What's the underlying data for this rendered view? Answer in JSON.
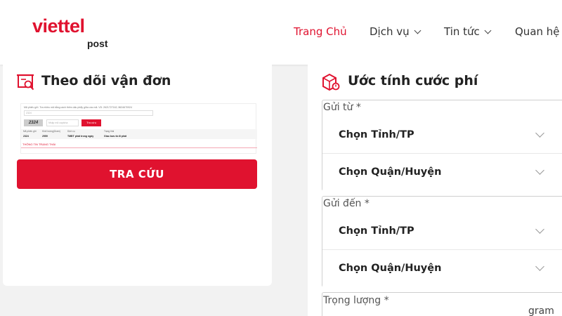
{
  "brand": {
    "name": "viettel",
    "sub": "post"
  },
  "nav": {
    "items": [
      {
        "label": "Trang Chủ",
        "active": true
      },
      {
        "label": "Dịch vụ",
        "dropdown": true
      },
      {
        "label": "Tin tức",
        "dropdown": true
      },
      {
        "label": "Quan hệ c",
        "dropdown": false
      }
    ]
  },
  "tracking": {
    "title": "Theo dõi vận đơn",
    "icon": "tracking-search-icon",
    "preview": {
      "hint": "Mã phiếu gửi. Tra nhiều mã bằng cách thêm dấu phẩy giữa các mã. VD: 2621727162, 8624670924",
      "input_placeholder": "2324",
      "captcha_text": "2324",
      "captcha_placeholder": "Nhập mã captcha",
      "button": "Tra cứu",
      "columns": [
        "Mã phiếu gửi",
        "Khối lượng(Gram)",
        "Dịch vụ",
        "Trạng thái"
      ],
      "values": [
        "2324",
        "2959",
        "TMĐT phát trong ngày",
        "Giao bưu tá đi phát"
      ],
      "status_heading": "THÔNG TIN TRẠNG THÁI"
    },
    "button_label": "TRA CỨU"
  },
  "estimate": {
    "title": "Ước tính cước phí",
    "icon": "shipping-box-icon",
    "from_legend": "Gửi từ *",
    "to_legend": "Gửi đến *",
    "weight_legend": "Trọng lượng *",
    "province_placeholder": "Chọn Tỉnh/TP",
    "district_placeholder": "Chọn Quận/Huyện",
    "weight_unit": "gram"
  },
  "colors": {
    "accent": "#e0122f"
  }
}
